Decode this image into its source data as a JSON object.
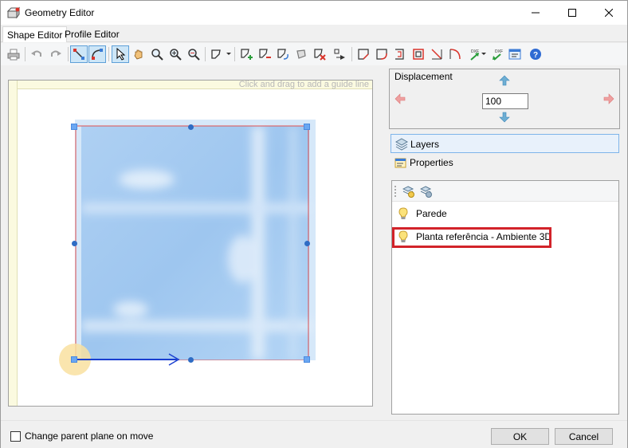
{
  "window": {
    "title": "Geometry Editor",
    "controls": {
      "minimize": "—",
      "maximize": "☐",
      "close": "✕"
    }
  },
  "tabs": [
    {
      "label": "Shape Editor",
      "active": true
    },
    {
      "label": "Profile Editor",
      "active": false
    }
  ],
  "toolbar": {
    "icons": [
      "print-icon",
      "undo-icon",
      "redo-icon",
      "edit-points-icon",
      "edit-curves-icon",
      "select-pointer-icon",
      "pan-hand-icon",
      "zoom-icon",
      "zoom-in-icon",
      "zoom-out-icon",
      "lasso-shape-icon",
      "add-point-icon",
      "remove-point-icon",
      "rotate-icon",
      "shape-icon",
      "delete-shape-icon",
      "move-icon",
      "cut-corner-icon",
      "fillet-icon",
      "offset-icon",
      "frame-icon",
      "diagonal-icon",
      "diagonal-arc-icon",
      "import-dxf-icon",
      "export-dxf-icon",
      "properties-icon",
      "help-icon"
    ]
  },
  "canvas": {
    "guide_hint": "Click and drag to add a guide line"
  },
  "displacement": {
    "label": "Displacement",
    "value": "100",
    "arrow_color": "#5aa0c8",
    "side_arrow_color": "#e88a8a"
  },
  "panel_tabs": [
    {
      "label": "Layers",
      "icon": "layers-icon",
      "active": true
    },
    {
      "label": "Properties",
      "icon": "properties-icon",
      "active": false
    }
  ],
  "layers": {
    "items": [
      {
        "label": "Parede",
        "icon": "lightbulb-icon"
      },
      {
        "label": "Planta referência - Ambiente 3D",
        "icon": "lightbulb-icon",
        "highlighted": true
      }
    ]
  },
  "footer": {
    "checkbox_label": "Change parent plane on move",
    "checkbox_checked": false,
    "ok": "OK",
    "cancel": "Cancel"
  },
  "colors": {
    "accent": "#0078d7",
    "highlight": "#d2232a",
    "shape_edge": "#e05050",
    "handle": "#6aa7f2",
    "direction_arrow": "#1a3fd0"
  }
}
